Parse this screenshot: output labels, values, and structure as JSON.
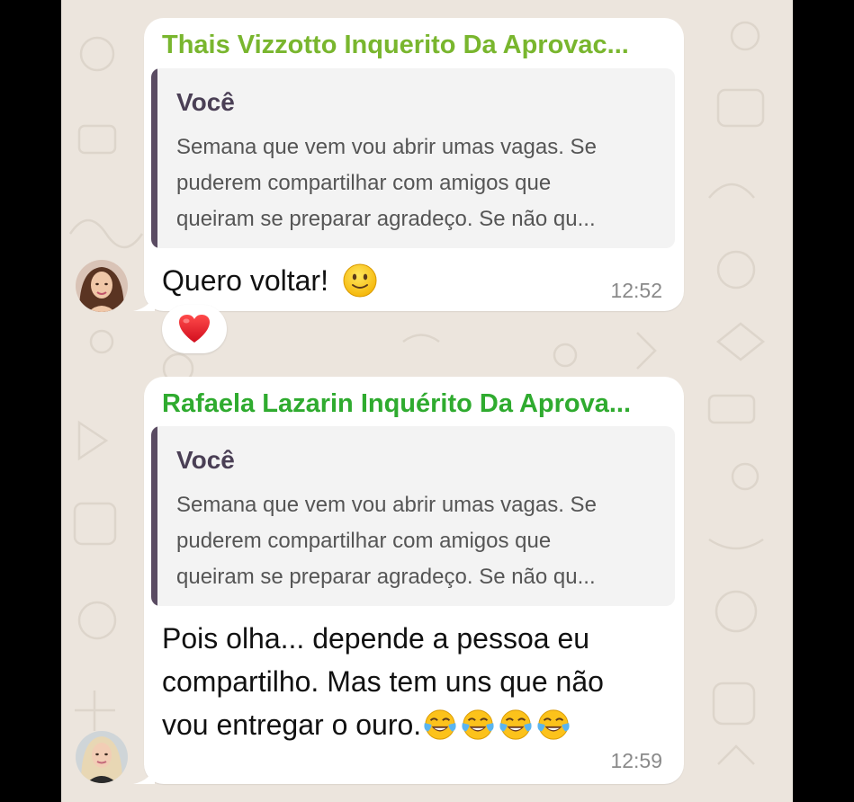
{
  "messages": [
    {
      "sender": "Thais Vizzotto Inquerito Da Aprovac...",
      "sender_color": "#79b62e",
      "quote": {
        "author": "Você",
        "lines": [
          "Semana que vem vou abrir umas vagas. Se",
          "puderem compartilhar com amigos que",
          "queiram se preparar agradeço. Se não qu..."
        ]
      },
      "text": "Quero voltar!",
      "emoji": "slightly-smiling-face-icon",
      "time": "12:52",
      "reaction": "red-heart-icon"
    },
    {
      "sender": "Rafaela Lazarin Inquérito Da Aprova...",
      "sender_color": "#2fab2f",
      "quote": {
        "author": "Você",
        "lines": [
          "Semana que vem vou abrir umas vagas. Se",
          "puderem compartilhar com amigos que",
          "queiram se preparar agradeço. Se não qu..."
        ]
      },
      "text_lines": [
        "Pois olha... depende a pessoa eu",
        "compartilho. Mas tem uns que não",
        "vou entregar o ouro."
      ],
      "emoji": "face-with-tears-of-joy-icon",
      "emoji_count": 4,
      "time": "12:59"
    }
  ],
  "colors": {
    "chat_background": "#ece5dd",
    "bubble": "#ffffff",
    "quote_bar": "#5a4b62"
  }
}
